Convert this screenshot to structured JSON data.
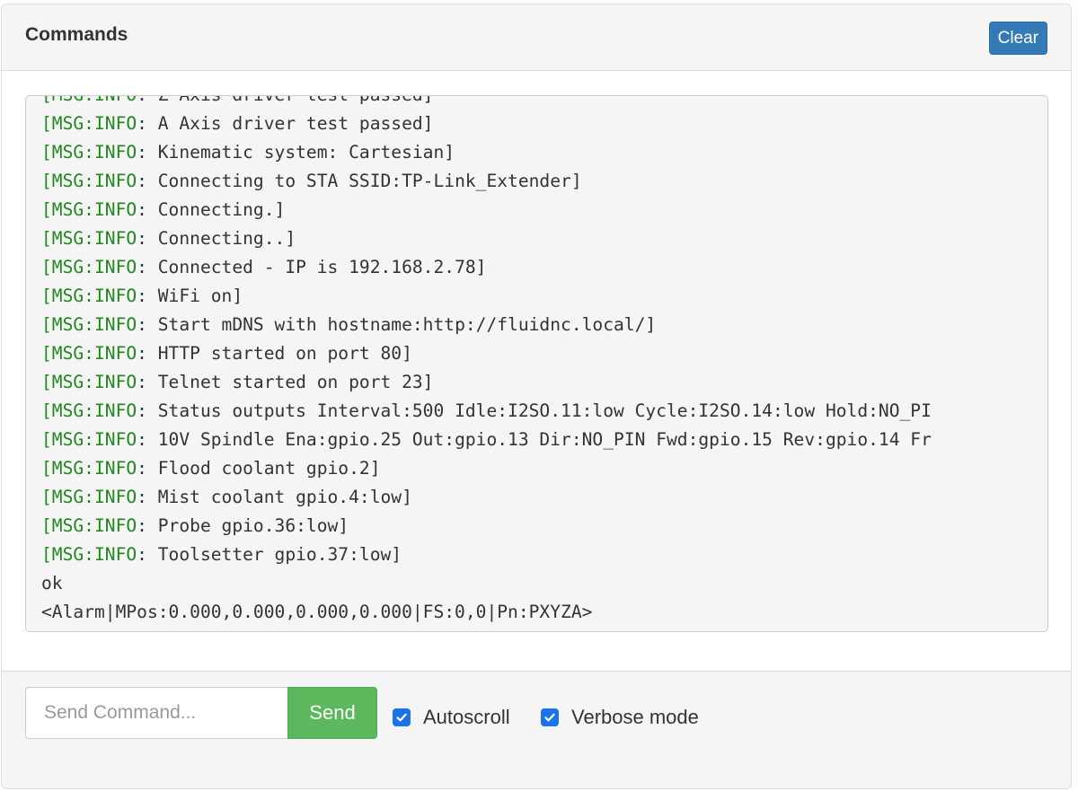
{
  "panel": {
    "title": "Commands",
    "clear_label": "Clear"
  },
  "console": {
    "lines": [
      {
        "tag": "[MSG:INFO",
        "text": ": Z Axis driver test passed]"
      },
      {
        "tag": "[MSG:INFO",
        "text": ": A Axis driver test passed]"
      },
      {
        "tag": "[MSG:INFO",
        "text": ": Kinematic system: Cartesian]"
      },
      {
        "tag": "[MSG:INFO",
        "text": ": Connecting to STA SSID:TP-Link_Extender]"
      },
      {
        "tag": "[MSG:INFO",
        "text": ": Connecting.]"
      },
      {
        "tag": "[MSG:INFO",
        "text": ": Connecting..]"
      },
      {
        "tag": "[MSG:INFO",
        "text": ": Connected - IP is 192.168.2.78]"
      },
      {
        "tag": "[MSG:INFO",
        "text": ": WiFi on]"
      },
      {
        "tag": "[MSG:INFO",
        "text": ": Start mDNS with hostname:http://fluidnc.local/]"
      },
      {
        "tag": "[MSG:INFO",
        "text": ": HTTP started on port 80]"
      },
      {
        "tag": "[MSG:INFO",
        "text": ": Telnet started on port 23]"
      },
      {
        "tag": "[MSG:INFO",
        "text": ": Status outputs Interval:500 Idle:I2SO.11:low Cycle:I2SO.14:low Hold:NO_PI"
      },
      {
        "tag": "[MSG:INFO",
        "text": ": 10V Spindle Ena:gpio.25 Out:gpio.13 Dir:NO_PIN Fwd:gpio.15 Rev:gpio.14 Fr"
      },
      {
        "tag": "[MSG:INFO",
        "text": ": Flood coolant gpio.2]"
      },
      {
        "tag": "[MSG:INFO",
        "text": ": Mist coolant gpio.4:low]"
      },
      {
        "tag": "[MSG:INFO",
        "text": ": Probe gpio.36:low]"
      },
      {
        "tag": "[MSG:INFO",
        "text": ": Toolsetter gpio.37:low]"
      },
      {
        "tag": "",
        "text": "ok"
      },
      {
        "tag": "",
        "text": "<Alarm|MPos:0.000,0.000,0.000,0.000|FS:0,0|Pn:PXYZA>"
      }
    ]
  },
  "footer": {
    "command_placeholder": "Send Command...",
    "command_value": "",
    "send_label": "Send",
    "autoscroll_label": "Autoscroll",
    "autoscroll_checked": true,
    "verbose_label": "Verbose mode",
    "verbose_checked": true
  },
  "colors": {
    "tag_green": "#228822",
    "clear_blue": "#337ab7",
    "send_green": "#5cb85c",
    "checkbox_blue": "#1a73e8"
  },
  "icons": [
    "check-icon"
  ]
}
